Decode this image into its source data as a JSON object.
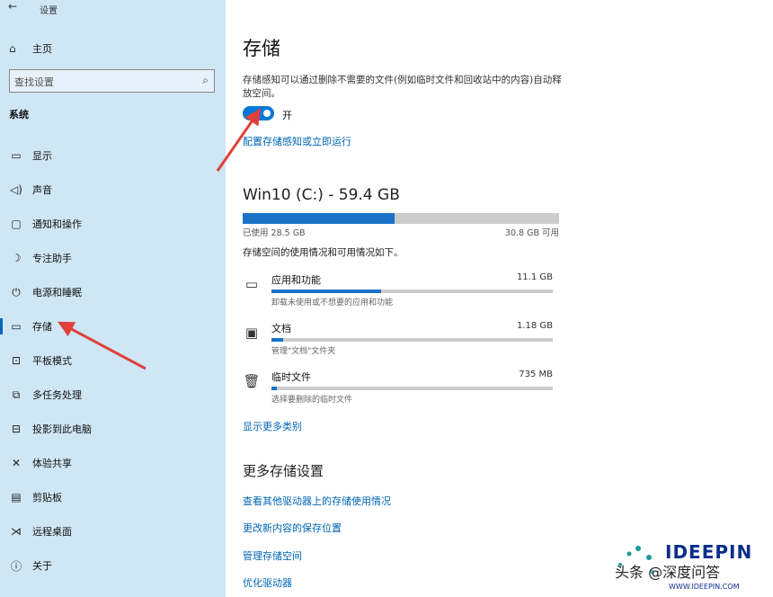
{
  "titlebar": {
    "back_glyph": "←",
    "app_title": "设置"
  },
  "home": {
    "icon": "home-icon",
    "label": "主页"
  },
  "search": {
    "placeholder": "查找设置",
    "icon": "search-icon"
  },
  "section_label": "系统",
  "nav": [
    {
      "icon": "display-icon",
      "glyph": "▭",
      "label": "显示"
    },
    {
      "icon": "sound-icon",
      "glyph": "◁)",
      "label": "声音"
    },
    {
      "icon": "notification-icon",
      "glyph": "▢",
      "label": "通知和操作"
    },
    {
      "icon": "focus-assist-icon",
      "glyph": "☽",
      "label": "专注助手"
    },
    {
      "icon": "power-icon",
      "glyph": "⏻",
      "label": "电源和睡眠"
    },
    {
      "icon": "storage-icon",
      "glyph": "▭",
      "label": "存储",
      "active": true
    },
    {
      "icon": "tablet-icon",
      "glyph": "⊡",
      "label": "平板模式"
    },
    {
      "icon": "multitasking-icon",
      "glyph": "⧉",
      "label": "多任务处理"
    },
    {
      "icon": "project-icon",
      "glyph": "⊟",
      "label": "投影到此电脑"
    },
    {
      "icon": "share-icon",
      "glyph": "✕",
      "label": "体验共享"
    },
    {
      "icon": "clipboard-icon",
      "glyph": "▤",
      "label": "剪贴板"
    },
    {
      "icon": "remote-desktop-icon",
      "glyph": "⋊",
      "label": "远程桌面"
    },
    {
      "icon": "about-icon",
      "glyph": "ⓘ",
      "label": "关于"
    }
  ],
  "main": {
    "title": "存储",
    "description": "存储感知可以通过删除不需要的文件(例如临时文件和回收站中的内容)自动释放空间。",
    "toggle": {
      "state": "on",
      "label": "开"
    },
    "configure_link": "配置存储感知或立即运行",
    "drive": {
      "title": "Win10 (C:) - 59.4 GB",
      "used_label": "已使用 28.5 GB",
      "free_label": "30.8 GB 可用",
      "used_fraction": 0.48
    },
    "usage_description": "存储空间的使用情况和可用情况如下。",
    "categories": [
      {
        "icon": "apps-icon",
        "glyph": "▭",
        "name": "应用和功能",
        "size": "11.1 GB",
        "fraction": 0.39,
        "desc": "卸载未使用或不想要的应用和功能"
      },
      {
        "icon": "documents-icon",
        "glyph": "▣",
        "name": "文档",
        "size": "1.18 GB",
        "fraction": 0.04,
        "desc": "管理\"文档\"文件夹"
      },
      {
        "icon": "trash-icon",
        "glyph": "🗑",
        "name": "临时文件",
        "size": "735 MB",
        "fraction": 0.02,
        "desc": "选择要删除的临时文件"
      }
    ],
    "show_more_link": "显示更多类别",
    "more_settings": {
      "title": "更多存储设置",
      "links": [
        "查看其他驱动器上的存储使用情况",
        "更改新内容的保存位置",
        "管理存储空间",
        "优化驱动器"
      ]
    }
  },
  "watermark": {
    "logo": "IDEEPIN",
    "url": "WWW.IDEEPIN.COM",
    "caption": "头条 @深度问答"
  },
  "colors": {
    "sidebar_bg": "#cfe6f5",
    "accent": "#0078d7",
    "link": "#0066b4",
    "arrow": "#e0403a"
  }
}
